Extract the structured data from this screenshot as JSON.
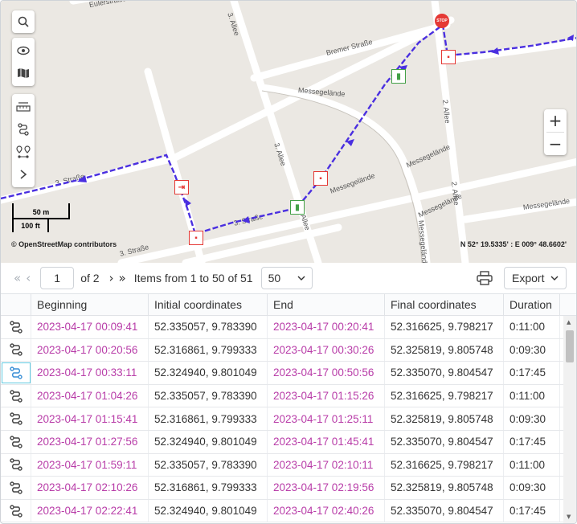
{
  "map": {
    "streets": [
      "Eulerstraße",
      "3. Allee",
      "3. Allee",
      "Bremer Straße",
      "Messegelände",
      "2. Allee",
      "Messegelände",
      "Messegelände",
      "Messegelände",
      "3. Straße",
      "3. Straße",
      "3. Straße",
      "Messegelände",
      "3. Allee",
      "2. Allee",
      "Messegelände"
    ],
    "scale_top": "50 m",
    "scale_bottom": "100 ft",
    "attribution": "© OpenStreetMap contributors",
    "coordinates": "N 52° 19.5335' : E 009° 48.6602'",
    "zoom_in": "+",
    "zoom_out": "−",
    "stop_label": "STOP",
    "track_color": "#4a2fe0",
    "icons": [
      "search-icon",
      "eye-icon",
      "map-icon",
      "ruler-icon",
      "route-icon",
      "pins-icon",
      "chevron-right-icon"
    ]
  },
  "pager": {
    "page": "1",
    "of_pages": "of 2",
    "items_text": "Items from 1 to 50 of 51",
    "per_page": "50",
    "export_label": "Export"
  },
  "table": {
    "columns": [
      "Beginning",
      "Initial coordinates",
      "End",
      "Final coordinates",
      "Duration"
    ],
    "rows": [
      {
        "begin": "2023-04-17 00:09:41",
        "init": "52.335057, 9.783390",
        "end": "2023-04-17 00:20:41",
        "final": "52.316625, 9.798217",
        "dur": "0:11:00"
      },
      {
        "begin": "2023-04-17 00:20:56",
        "init": "52.316861, 9.799333",
        "end": "2023-04-17 00:30:26",
        "final": "52.325819, 9.805748",
        "dur": "0:09:30"
      },
      {
        "begin": "2023-04-17 00:33:11",
        "init": "52.324940, 9.801049",
        "end": "2023-04-17 00:50:56",
        "final": "52.335070, 9.804547",
        "dur": "0:17:45"
      },
      {
        "begin": "2023-04-17 01:04:26",
        "init": "52.335057, 9.783390",
        "end": "2023-04-17 01:15:26",
        "final": "52.316625, 9.798217",
        "dur": "0:11:00"
      },
      {
        "begin": "2023-04-17 01:15:41",
        "init": "52.316861, 9.799333",
        "end": "2023-04-17 01:25:11",
        "final": "52.325819, 9.805748",
        "dur": "0:09:30"
      },
      {
        "begin": "2023-04-17 01:27:56",
        "init": "52.324940, 9.801049",
        "end": "2023-04-17 01:45:41",
        "final": "52.335070, 9.804547",
        "dur": "0:17:45"
      },
      {
        "begin": "2023-04-17 01:59:11",
        "init": "52.335057, 9.783390",
        "end": "2023-04-17 02:10:11",
        "final": "52.316625, 9.798217",
        "dur": "0:11:00"
      },
      {
        "begin": "2023-04-17 02:10:26",
        "init": "52.316861, 9.799333",
        "end": "2023-04-17 02:19:56",
        "final": "52.325819, 9.805748",
        "dur": "0:09:30"
      },
      {
        "begin": "2023-04-17 02:22:41",
        "init": "52.324940, 9.801049",
        "end": "2023-04-17 02:40:26",
        "final": "52.335070, 9.804547",
        "dur": "0:17:45"
      }
    ]
  }
}
